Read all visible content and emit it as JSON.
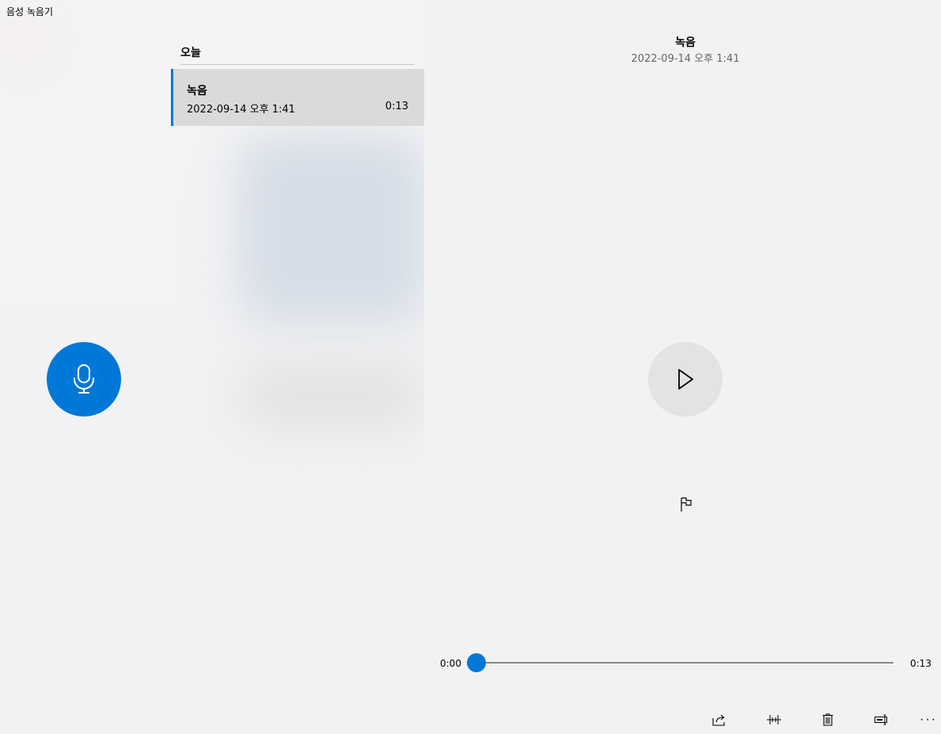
{
  "app": {
    "title": "음성 녹음기"
  },
  "window_controls": {
    "minimize_icon": "minimize-icon",
    "maximize_icon": "maximize-icon",
    "close_icon": "close-icon"
  },
  "list": {
    "section_header": "오늘",
    "items": [
      {
        "name": "녹음",
        "date": "2022-09-14 오후 1:41",
        "duration": "0:13",
        "selected": true
      }
    ]
  },
  "record_button": {
    "icon": "microphone-icon",
    "color": "#0078d7"
  },
  "player": {
    "title": "녹음",
    "date": "2022-09-14 오후 1:41",
    "play_icon": "play-icon",
    "marker_icon": "flag-icon",
    "time_current": "0:00",
    "time_total": "0:13",
    "progress": 0.0
  },
  "toolbar": {
    "share_icon": "share-icon",
    "trim_icon": "trim-icon",
    "delete_icon": "delete-icon",
    "rename_icon": "rename-icon",
    "more_label": "···"
  },
  "colors": {
    "accent": "#0078d7",
    "selected_item_bg": "#dadada",
    "play_button_bg": "#e3e3e3"
  }
}
